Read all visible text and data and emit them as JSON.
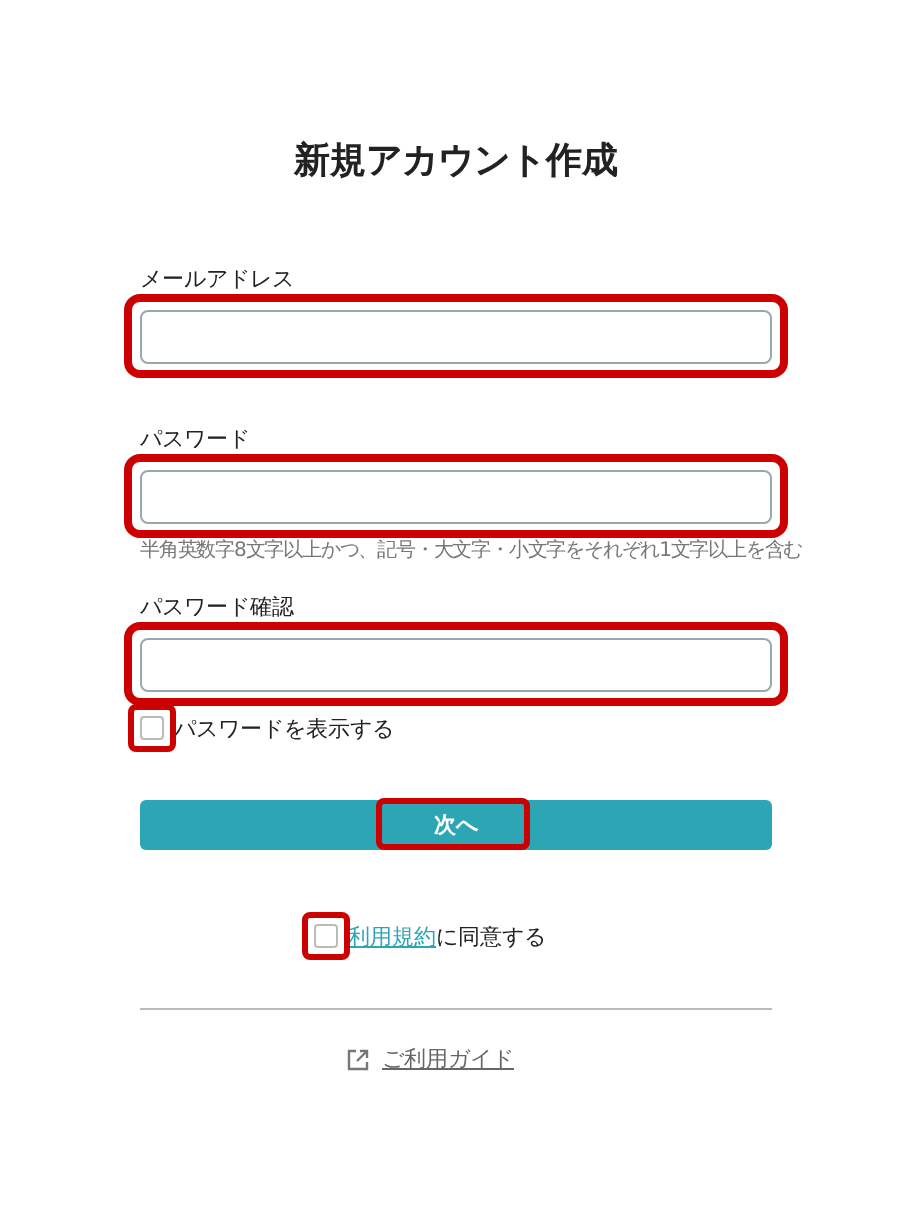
{
  "title": "新規アカウント作成",
  "fields": [
    {
      "label": "メールアドレス",
      "highlighted": true
    },
    {
      "label": "パスワード",
      "hint": "半角英数字8文字以上かつ、記号・大文字・小文字をそれぞれ1文字以上を含む",
      "highlighted": true
    },
    {
      "label": "パスワード確認",
      "highlighted": true
    }
  ],
  "show_password": {
    "label": "パスワードを表示する",
    "checked": false,
    "highlighted": true
  },
  "next_button": {
    "label": "次へ",
    "highlighted": true
  },
  "agree": {
    "link": "利用規約",
    "text": "に同意する",
    "checked": false,
    "highlighted": true
  },
  "guide_link": {
    "label": "ご利用ガイド"
  }
}
